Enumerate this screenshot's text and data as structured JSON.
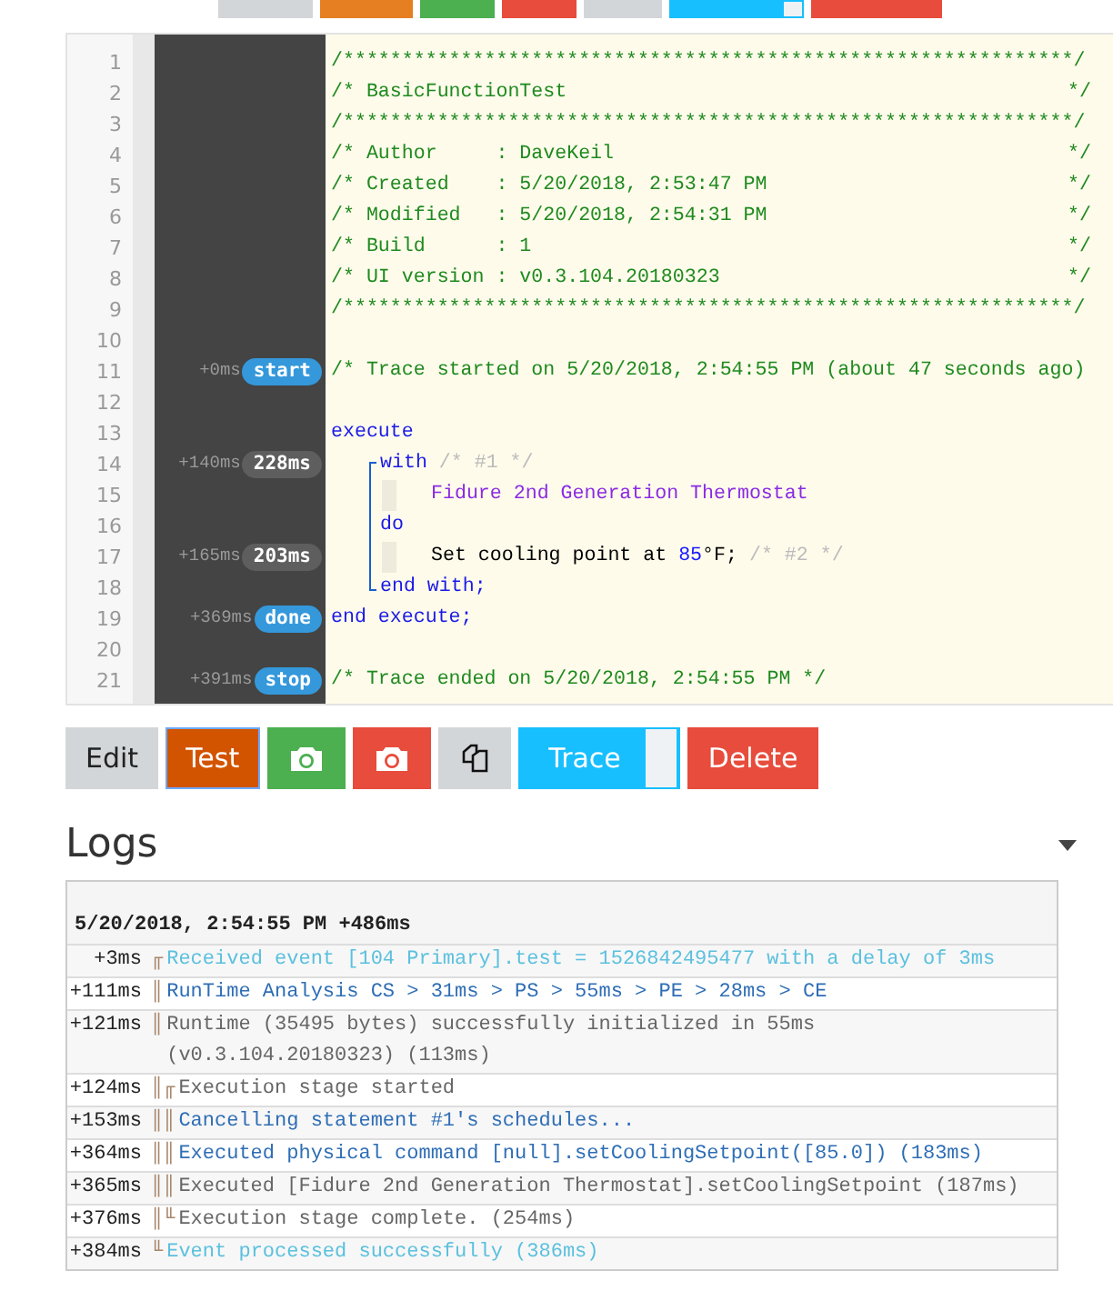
{
  "top_toolbar": [
    {
      "color": "#d3d6d8",
      "kind": "plain"
    },
    {
      "color": "#e67e22",
      "kind": "plain"
    },
    {
      "color": "#4caf50",
      "kind": "plain"
    },
    {
      "color": "#e74c3c",
      "kind": "plain"
    },
    {
      "color": "#d3d6d8",
      "kind": "plain"
    },
    {
      "color": "#17bfff",
      "kind": "toggle"
    },
    {
      "color": "#e74c3c",
      "kind": "plain"
    }
  ],
  "gutter": [
    {
      "number": "1"
    },
    {
      "number": "2"
    },
    {
      "number": "3"
    },
    {
      "number": "4"
    },
    {
      "number": "5"
    },
    {
      "number": "6"
    },
    {
      "number": "7"
    },
    {
      "number": "8"
    },
    {
      "number": "9"
    },
    {
      "number": "10"
    },
    {
      "number": "11",
      "offset": "+0ms",
      "badge": {
        "text": "start",
        "kind": "event"
      }
    },
    {
      "number": "12"
    },
    {
      "number": "13"
    },
    {
      "number": "14",
      "offset": "+140ms",
      "badge": {
        "text": "228ms",
        "kind": "duration"
      }
    },
    {
      "number": "15"
    },
    {
      "number": "16"
    },
    {
      "number": "17",
      "offset": "+165ms",
      "badge": {
        "text": "203ms",
        "kind": "duration"
      }
    },
    {
      "number": "18"
    },
    {
      "number": "19",
      "offset": "+369ms",
      "badge": {
        "text": "done",
        "kind": "event"
      }
    },
    {
      "number": "20"
    },
    {
      "number": "21",
      "offset": "+391ms",
      "badge": {
        "text": "stop",
        "kind": "event"
      }
    }
  ],
  "code": [
    {
      "kind": "line",
      "tokens": [
        {
          "text": "/**************************************************************/",
          "kind": "comment"
        }
      ]
    },
    {
      "kind": "line",
      "tokens": [
        {
          "text": "/* BasicFunctionTest",
          "kind": "comment"
        }
      ],
      "tail": "*/"
    },
    {
      "kind": "line",
      "tokens": [
        {
          "text": "/**************************************************************/",
          "kind": "comment"
        }
      ]
    },
    {
      "kind": "line",
      "tokens": [
        {
          "text": "/* Author     : DaveKeil",
          "kind": "comment"
        }
      ],
      "tail": "*/"
    },
    {
      "kind": "line",
      "tokens": [
        {
          "text": "/* Created    : 5/20/2018, 2:53:47 PM",
          "kind": "comment"
        }
      ],
      "tail": "*/"
    },
    {
      "kind": "line",
      "tokens": [
        {
          "text": "/* Modified   : 5/20/2018, 2:54:31 PM",
          "kind": "comment"
        }
      ],
      "tail": "*/"
    },
    {
      "kind": "line",
      "tokens": [
        {
          "text": "/* Build      : 1",
          "kind": "comment"
        }
      ],
      "tail": "*/"
    },
    {
      "kind": "line",
      "tokens": [
        {
          "text": "/* UI version : v0.3.104.20180323",
          "kind": "comment"
        }
      ],
      "tail": "*/"
    },
    {
      "kind": "line",
      "tokens": [
        {
          "text": "/**************************************************************/",
          "kind": "comment"
        }
      ]
    },
    {
      "kind": "blank"
    },
    {
      "kind": "line",
      "tokens": [
        {
          "text": "/* Trace started on 5/20/2018, 2:54:55 PM (about 47 seconds ago)",
          "kind": "comment"
        }
      ]
    },
    {
      "kind": "blank"
    },
    {
      "kind": "line",
      "tokens": [
        {
          "text": "execute",
          "kind": "keyword"
        }
      ]
    },
    {
      "kind": "block",
      "children": [
        {
          "kind": "bracket",
          "children": [
            {
              "kind": "line",
              "tokens": [
                {
                  "text": "with",
                  "kind": "keyword"
                },
                {
                  "text": " /* #1 */",
                  "kind": "note"
                }
              ]
            },
            {
              "kind": "step",
              "tokens": [
                {
                  "text": "Fidure 2nd Generation Thermostat",
                  "kind": "device"
                }
              ]
            },
            {
              "kind": "line",
              "tokens": [
                {
                  "text": "do",
                  "kind": "keyword"
                }
              ]
            },
            {
              "kind": "step",
              "tokens": [
                {
                  "text": "Set cooling point at ",
                  "kind": "plain"
                },
                {
                  "text": "85",
                  "kind": "number"
                },
                {
                  "text": "°F;",
                  "kind": "plain"
                },
                {
                  "text": " /* #2 */",
                  "kind": "note"
                }
              ]
            },
            {
              "kind": "line",
              "tokens": [
                {
                  "text": "end with;",
                  "kind": "keyword"
                }
              ]
            }
          ]
        }
      ]
    },
    {
      "kind": "line",
      "tokens": [
        {
          "text": "end execute;",
          "kind": "keyword"
        }
      ]
    },
    {
      "kind": "blank"
    },
    {
      "kind": "line",
      "tokens": [
        {
          "text": "/* Trace ended on 5/20/2018, 2:54:55 PM */",
          "kind": "comment"
        }
      ]
    }
  ],
  "buttons": [
    {
      "label": "Edit",
      "kind": "label",
      "color": "#d3d6d8",
      "selected": false
    },
    {
      "label": "Test",
      "kind": "label",
      "color": "#d35400",
      "selected": true
    },
    {
      "kind": "camera",
      "color": "#4caf50",
      "selected": false
    },
    {
      "kind": "camera",
      "color": "#e74c3c",
      "selected": false
    },
    {
      "kind": "pages",
      "color": "#d3d6d8",
      "selected": false
    },
    {
      "label": "Trace",
      "kind": "toggle",
      "color": "#17bfff",
      "selected": false
    },
    {
      "label": "Delete",
      "kind": "label",
      "color": "#e74c3c",
      "selected": false
    }
  ],
  "logs": {
    "title": "Logs",
    "expanded": true,
    "header": "5/20/2018, 2:54:55 PM +486ms",
    "rows": [
      {
        "time": "+3ms",
        "prefix": "╓",
        "message": "Received event [104 Primary].test = 1526842495477 with a delay of 3ms",
        "kind": "event"
      },
      {
        "time": "+111ms",
        "prefix": "║",
        "message": "RunTime Analysis CS > 31ms > PS > 55ms > PE > 28ms > CE",
        "kind": "info"
      },
      {
        "time": "+121ms",
        "prefix": "║",
        "message": "Runtime (35495 bytes) successfully initialized in 55ms\n(v0.3.104.20180323) (113ms)",
        "kind": "plain"
      },
      {
        "time": "+124ms",
        "prefix": "║╓",
        "message": "Execution stage started",
        "kind": "plain"
      },
      {
        "time": "+153ms",
        "prefix": "║║",
        "message": "Cancelling statement #1's schedules...",
        "kind": "info"
      },
      {
        "time": "+364ms",
        "prefix": "║║",
        "message": "Executed physical command [null].setCoolingSetpoint([85.0]) (183ms)",
        "kind": "info"
      },
      {
        "time": "+365ms",
        "prefix": "║║",
        "message": "Executed [Fidure 2nd Generation Thermostat].setCoolingSetpoint (187ms)",
        "kind": "plain"
      },
      {
        "time": "+376ms",
        "prefix": "║╙",
        "message": "Execution stage complete. (254ms)",
        "kind": "plain"
      },
      {
        "time": "+384ms",
        "prefix": "╙",
        "message": "Event processed successfully (386ms)",
        "kind": "event"
      }
    ]
  }
}
